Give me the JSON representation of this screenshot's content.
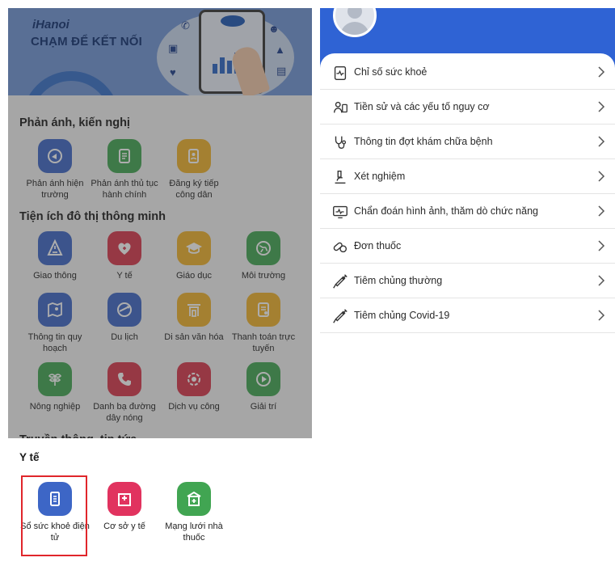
{
  "banner": {
    "brand": "iHanoi",
    "tagline": "CHẠM ĐỂ KẾT NỐI",
    "phone_logo": "iHanoi"
  },
  "colors": {
    "blue_tile": "#3d66c6",
    "green_tile": "#41a552",
    "yellow_tile": "#efb12a",
    "red_tile": "#d8364a",
    "pink_tile": "#e1335f",
    "header_blue": "#2f63d4",
    "highlight": "#e0262b"
  },
  "sections": {
    "feedback_title": "Phản ánh, kiến nghị",
    "smart_title": "Tiện ích đô thị thông minh",
    "news_title": "Truyền thông, tin tức"
  },
  "feedback_items": [
    {
      "label": "Phản ánh hiện trường",
      "icon": "megaphone-icon"
    },
    {
      "label": "Phản ánh thủ tục hành chính",
      "icon": "document-icon"
    },
    {
      "label": "Đăng ký tiếp công dân",
      "icon": "form-edit-icon"
    }
  ],
  "smart_items": [
    {
      "label": "Giao thông",
      "icon": "traffic-icon"
    },
    {
      "label": "Y tế",
      "icon": "heart-icon"
    },
    {
      "label": "Giáo dục",
      "icon": "graduation-cap-icon"
    },
    {
      "label": "Môi trường",
      "icon": "globe-icon"
    },
    {
      "label": "Thông tin quy hoạch",
      "icon": "map-icon"
    },
    {
      "label": "Du lịch",
      "icon": "travel-globe-icon"
    },
    {
      "label": "Di sản văn hóa",
      "icon": "temple-gate-icon"
    },
    {
      "label": "Thanh toán trực tuyến",
      "icon": "payment-icon"
    },
    {
      "label": "Nông nghiệp",
      "icon": "plant-icon"
    },
    {
      "label": "Danh bạ đường dây nóng",
      "icon": "phone-icon"
    },
    {
      "label": "Dịch vụ công",
      "icon": "services-icon"
    },
    {
      "label": "Giải trí",
      "icon": "play-icon"
    }
  ],
  "sheet": {
    "title": "Y tế",
    "items": [
      {
        "label": "Sổ sức khoẻ điện tử",
        "icon": "health-book-icon"
      },
      {
        "label": "Cơ sở y tế",
        "icon": "hospital-icon"
      },
      {
        "label": "Mạng lưới nhà thuốc",
        "icon": "pharmacy-icon"
      }
    ]
  },
  "health_menu": [
    {
      "label": "Chỉ số sức khoẻ",
      "icon": "health-index-icon"
    },
    {
      "label": "Tiền sử và các yếu tố nguy cơ",
      "icon": "history-icon"
    },
    {
      "label": "Thông tin đợt khám chữa bệnh",
      "icon": "stethoscope-icon"
    },
    {
      "label": "Xét nghiệm",
      "icon": "microscope-icon"
    },
    {
      "label": "Chẩn đoán hình ảnh, thăm dò chức năng",
      "icon": "monitor-icon"
    },
    {
      "label": "Đơn thuốc",
      "icon": "pill-icon"
    },
    {
      "label": "Tiêm chủng thường",
      "icon": "syringe-icon"
    },
    {
      "label": "Tiêm chủng Covid-19",
      "icon": "syringe-icon"
    }
  ]
}
